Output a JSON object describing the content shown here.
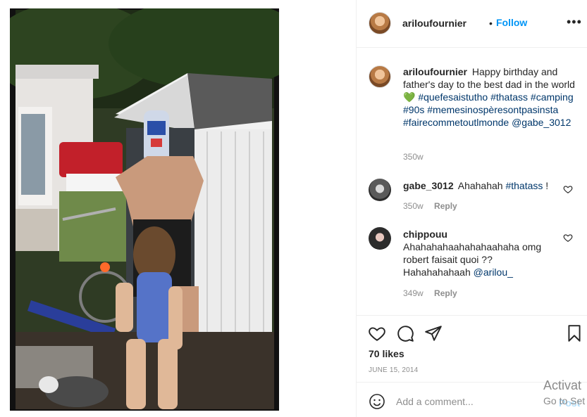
{
  "post": {
    "username": "ariloufournier",
    "follow_label": "Follow",
    "separator": "•",
    "more_label": "•••"
  },
  "caption": {
    "username": "ariloufournier",
    "text": "Happy birthday and father's day to the best dad in the world",
    "emoji": "💚",
    "hashtags": [
      "#quefesaistutho",
      "#thatass",
      "#camping",
      "#90s",
      "#memesinospèresontpasinsta",
      "#fairecommetoutlmonde"
    ],
    "mention": "@gabe_3012",
    "time": "350w"
  },
  "comments": [
    {
      "username": "gabe_3012",
      "text": "Ahahahah",
      "tag": "#thatass",
      "suffix": "!",
      "time": "350w",
      "reply_label": "Reply"
    },
    {
      "username": "chippouu",
      "text": "Ahahahahaahahahaahaha omg robert faisait quoi ?? Hahahahahaah",
      "mention": "@arilou_",
      "time": "349w",
      "reply_label": "Reply"
    }
  ],
  "actions": {
    "likes": "70 likes",
    "date": "JUNE 15, 2014",
    "icons": [
      "heart-icon",
      "comment-icon",
      "share-icon",
      "bookmark-icon"
    ]
  },
  "add_comment": {
    "placeholder": "Add a comment...",
    "post_label": "Post"
  },
  "watermark": {
    "line1": "Activat",
    "line2": "Go to Set"
  },
  "colors": {
    "link_blue": "#0095f6",
    "hashtag": "#00376b",
    "muted": "#8e8e8e",
    "heart_green": "#2bbf2b"
  }
}
